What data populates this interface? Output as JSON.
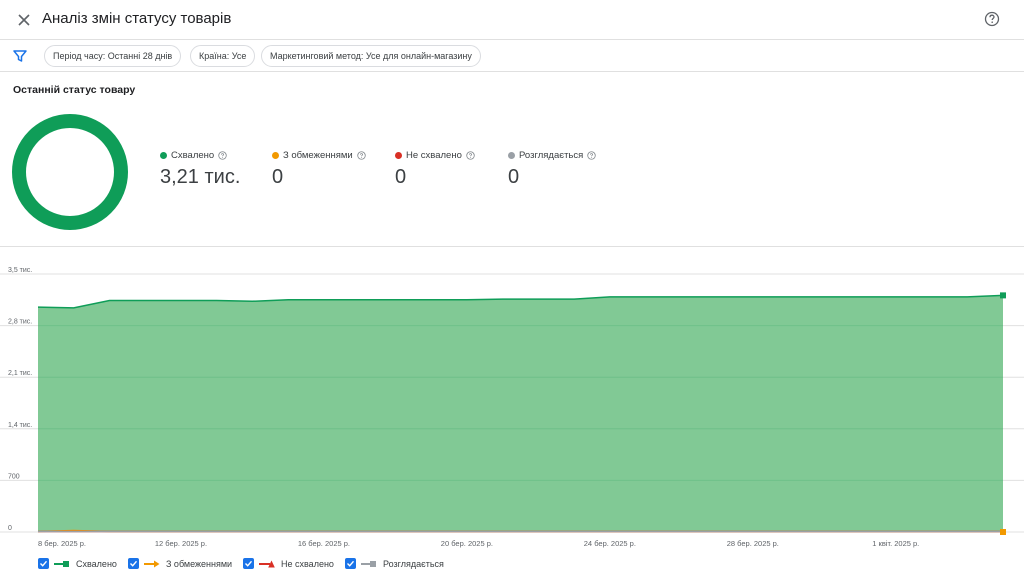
{
  "header": {
    "title": "Аналіз змін статусу товарів"
  },
  "filters": [
    {
      "label": "Період часу: Останні 28 днів"
    },
    {
      "label": "Країна: Усе"
    },
    {
      "label": "Маркетинговий метод: Усе для онлайн-магазину"
    }
  ],
  "summary": {
    "title": "Останній статус товару",
    "stats": [
      {
        "label": "Схвалено",
        "value": "3,21 тис.",
        "color": "#0f9d58"
      },
      {
        "label": "З обмеженнями",
        "value": "0",
        "color": "#f29900"
      },
      {
        "label": "Не схвалено",
        "value": "0",
        "color": "#d93025"
      },
      {
        "label": "Розглядається",
        "value": "0",
        "color": "#9aa0a6"
      }
    ]
  },
  "chart_data": {
    "type": "area",
    "x": [
      "8 бер. 2025 р.",
      "9 бер. 2025 р.",
      "10 бер. 2025 р.",
      "11 бер. 2025 р.",
      "12 бер. 2025 р.",
      "13 бер. 2025 р.",
      "14 бер. 2025 р.",
      "15 бер. 2025 р.",
      "16 бер. 2025 р.",
      "17 бер. 2025 р.",
      "18 бер. 2025 р.",
      "19 бер. 2025 р.",
      "20 бер. 2025 р.",
      "21 бер. 2025 р.",
      "22 бер. 2025 р.",
      "23 бер. 2025 р.",
      "24 бер. 2025 р.",
      "25 бер. 2025 р.",
      "26 бер. 2025 р.",
      "27 бер. 2025 р.",
      "28 бер. 2025 р.",
      "29 бер. 2025 р.",
      "30 бер. 2025 р.",
      "31 бер. 2025 р.",
      "1 квіт. 2025 р.",
      "2 квіт. 2025 р.",
      "3 квіт. 2025 р.",
      "4 квіт. 2025 р."
    ],
    "x_tick_labels": [
      "8 бер. 2025 р.",
      "12 бер. 2025 р.",
      "16 бер. 2025 р.",
      "20 бер. 2025 р.",
      "24 бер. 2025 р.",
      "28 бер. 2025 р.",
      "1 квіт. 2025 р."
    ],
    "y_tick_labels": [
      "0",
      "700",
      "1,4 тис.",
      "2,1 тис.",
      "2,8 тис.",
      "3,5 тис."
    ],
    "ylim": [
      0,
      3500
    ],
    "series": [
      {
        "name": "Схвалено",
        "color": "#0f9d58",
        "fill": "#81c995",
        "values": [
          3050,
          3040,
          3140,
          3140,
          3140,
          3140,
          3130,
          3150,
          3150,
          3150,
          3150,
          3150,
          3150,
          3160,
          3160,
          3160,
          3190,
          3190,
          3190,
          3190,
          3190,
          3190,
          3190,
          3190,
          3190,
          3190,
          3190,
          3210
        ]
      },
      {
        "name": "З обмеженнями",
        "color": "#f29900",
        "values": [
          0,
          15,
          0,
          0,
          0,
          0,
          0,
          0,
          0,
          0,
          0,
          0,
          0,
          0,
          0,
          0,
          0,
          0,
          0,
          0,
          0,
          0,
          0,
          0,
          0,
          0,
          0,
          0
        ]
      },
      {
        "name": "Не схвалено",
        "color": "#d93025",
        "values": [
          0,
          0,
          0,
          0,
          0,
          0,
          0,
          0,
          0,
          0,
          0,
          0,
          0,
          0,
          0,
          0,
          0,
          0,
          0,
          0,
          0,
          0,
          0,
          0,
          0,
          0,
          0,
          0
        ]
      },
      {
        "name": "Розглядається",
        "color": "#9aa0a6",
        "values": [
          0,
          0,
          0,
          0,
          0,
          0,
          0,
          0,
          0,
          0,
          0,
          0,
          0,
          0,
          0,
          0,
          0,
          0,
          0,
          0,
          0,
          0,
          0,
          0,
          0,
          0,
          0,
          0
        ]
      }
    ],
    "grid": true
  },
  "legend": [
    {
      "label": "Схвалено",
      "checked": true,
      "color": "#0f9d58"
    },
    {
      "label": "З обмеженнями",
      "checked": true,
      "color": "#f29900"
    },
    {
      "label": "Не схвалено",
      "checked": true,
      "color": "#d93025"
    },
    {
      "label": "Розглядається",
      "checked": true,
      "color": "#9aa0a6"
    }
  ],
  "icons": {
    "close": "close-icon",
    "help": "help-icon",
    "filter": "filter-icon"
  }
}
